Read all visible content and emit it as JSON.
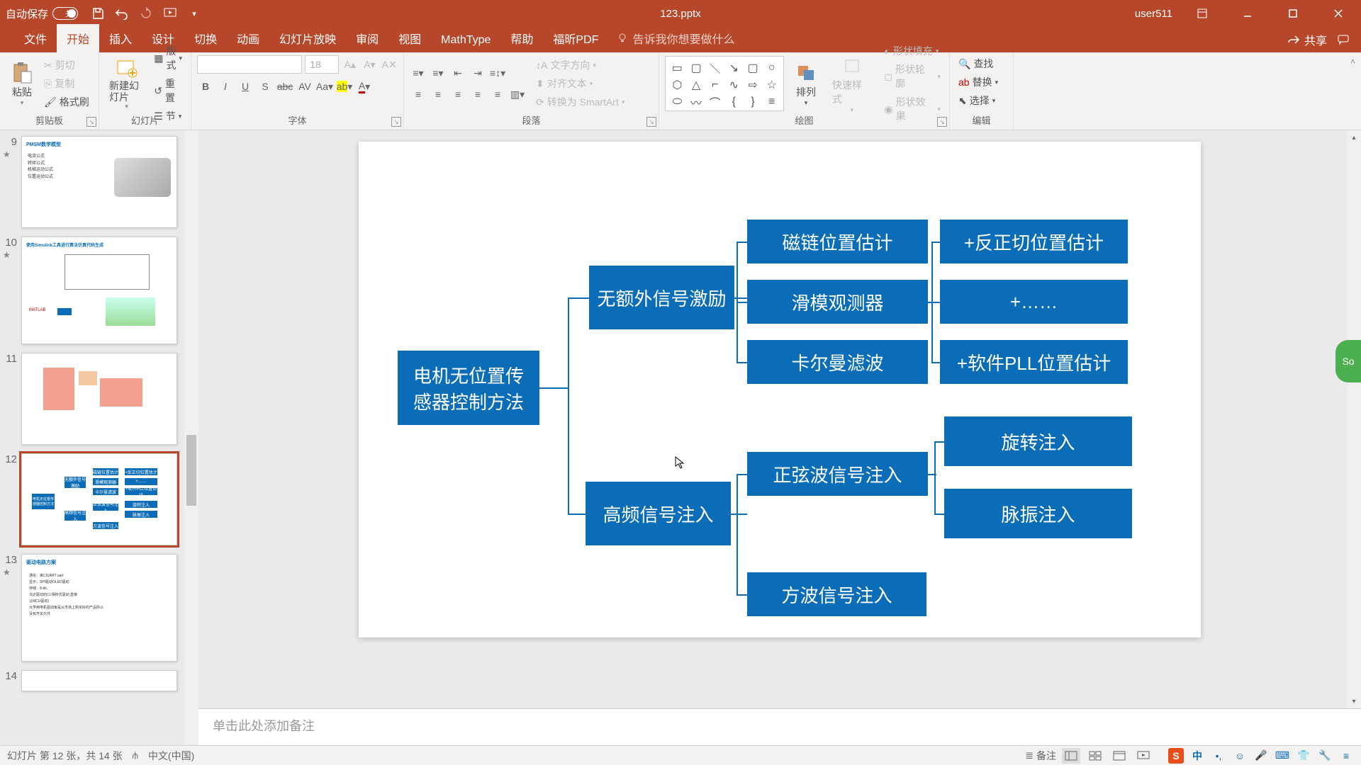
{
  "titlebar": {
    "autosave": "自动保存",
    "autosave_state": "关",
    "filename": "123.pptx",
    "user": "user511"
  },
  "tabs": {
    "file": "文件",
    "home": "开始",
    "insert": "插入",
    "design": "设计",
    "transitions": "切换",
    "animations": "动画",
    "slideshow": "幻灯片放映",
    "review": "审阅",
    "view": "视图",
    "mathtype": "MathType",
    "help": "帮助",
    "foxitpdf": "福昕PDF",
    "tellme": "告诉我你想要做什么",
    "share": "共享"
  },
  "ribbon": {
    "clipboard": {
      "label": "剪贴板",
      "paste": "粘贴",
      "cut": "剪切",
      "copy": "复制",
      "format": "格式刷"
    },
    "slides": {
      "label": "幻灯片",
      "new": "新建幻灯片",
      "layout": "版式",
      "reset": "重置",
      "section": "节"
    },
    "font": {
      "label": "字体",
      "size": "18"
    },
    "paragraph": {
      "label": "段落",
      "textdir": "文字方向",
      "align": "对齐文本",
      "smartart": "转换为 SmartArt"
    },
    "drawing": {
      "label": "绘图",
      "arrange": "排列",
      "quickstyle": "快速样式",
      "fill": "形状填充",
      "outline": "形状轮廓",
      "effects": "形状效果"
    },
    "editing": {
      "label": "编辑",
      "find": "查找",
      "replace": "替换",
      "select": "选择"
    }
  },
  "thumbs": {
    "s9": {
      "num": "9",
      "title": "PMSM数学模型"
    },
    "s10": {
      "num": "10",
      "title": "使用Simulink工具进行算法仿真代码生成"
    },
    "s11": {
      "num": "11"
    },
    "s12": {
      "num": "12"
    },
    "s13": {
      "num": "13",
      "title": "驱动电路方案"
    },
    "s14": {
      "num": "14"
    }
  },
  "diagram": {
    "root": "电机无位置传感器控制方法",
    "b1": "无额外信号激励",
    "b2": "高频信号注入",
    "c1": "磁链位置估计",
    "c2": "滑模观测器",
    "c3": "卡尔曼滤波",
    "c4": "正弦波信号注入",
    "c5": "方波信号注入",
    "d1": "+反正切位置估计",
    "d2": "+……",
    "d3": "+软件PLL位置估计",
    "d4": "旋转注入",
    "d5": "脉振注入"
  },
  "notes": {
    "placeholder": "单击此处添加备注"
  },
  "status": {
    "slideinfo": "幻灯片 第 12 张，共 14 张",
    "lang": "中文(中国)",
    "notes": "备注",
    "ime": "中"
  },
  "float": {
    "label": "So"
  }
}
